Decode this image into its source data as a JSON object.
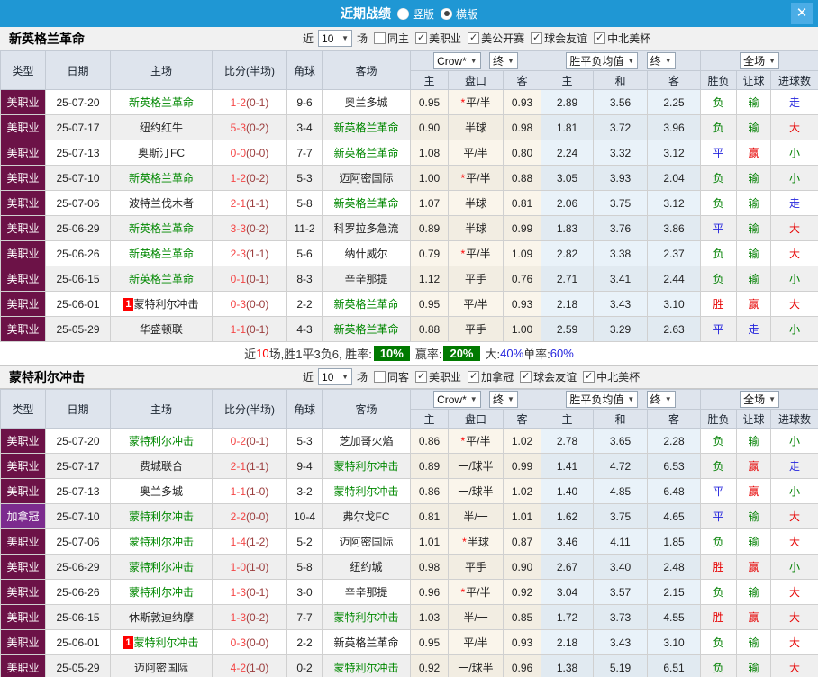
{
  "titlebar": {
    "title": "近期战绩",
    "layout_vertical": "竖版",
    "layout_horizontal": "横版",
    "selected_layout": "横版",
    "close_icon": "✕"
  },
  "table_header": {
    "type": "类型",
    "date": "日期",
    "home": "主场",
    "score": "比分(半场)",
    "corner": "角球",
    "away": "客场",
    "odds_home": "主",
    "odds_line": "盘口",
    "odds_away": "客",
    "avg_home": "主",
    "avg_draw": "和",
    "avg_away": "客",
    "wdl": "胜负",
    "handicap": "让球",
    "goals": "进球数"
  },
  "table_controls": {
    "company": "Crow*",
    "final_left": "终",
    "avg_title": "胜平负均值",
    "final_mid": "终",
    "scope": "全场"
  },
  "colors": {
    "titlebar_bg": "#1f97d4",
    "close_btn_bg": "#4bade6",
    "league_bg": {
      "美职业": "#6c1247",
      "加拿冠": "#7c2b8e"
    },
    "result": {
      "r": "#e60000",
      "b": "#2424dd",
      "g": "#008000"
    },
    "team_highlight": "#008800",
    "score_ft": "#f54545",
    "score_ht": "#9a3c3c",
    "pct_badge_bg": "#007a00",
    "pct_blue": "#2424dd"
  },
  "sections": [
    {
      "team": "新英格兰革命",
      "filters": {
        "near_label": "近",
        "count": "10",
        "unit_label": "场",
        "same_label": "同主",
        "same_checked": false,
        "leagues": [
          "美职业",
          "美公开赛",
          "球会友谊",
          "中北美杯"
        ]
      },
      "rows": [
        {
          "type": "美职业",
          "date": "25-07-20",
          "home": "新英格兰革命",
          "home_hl": true,
          "home_badge": "",
          "ft": "1-2",
          "ht": "(0-1)",
          "corner": "9-6",
          "away": "奥兰多城",
          "away_hl": false,
          "odds": [
            "0.95",
            "*平/半",
            "0.93"
          ],
          "avg": [
            "2.89",
            "3.56",
            "2.25"
          ],
          "res": [
            [
              "负",
              "g"
            ],
            [
              "输",
              "g"
            ],
            [
              "走",
              "b"
            ]
          ]
        },
        {
          "type": "美职业",
          "date": "25-07-17",
          "home": "纽约红牛",
          "home_hl": false,
          "home_badge": "",
          "ft": "5-3",
          "ht": "(0-2)",
          "corner": "3-4",
          "away": "新英格兰革命",
          "away_hl": true,
          "odds": [
            "0.90",
            "半球",
            "0.98"
          ],
          "avg": [
            "1.81",
            "3.72",
            "3.96"
          ],
          "res": [
            [
              "负",
              "g"
            ],
            [
              "输",
              "g"
            ],
            [
              "大",
              "r"
            ]
          ]
        },
        {
          "type": "美职业",
          "date": "25-07-13",
          "home": "奥斯汀FC",
          "home_hl": false,
          "home_badge": "",
          "ft": "0-0",
          "ht": "(0-0)",
          "corner": "7-7",
          "away": "新英格兰革命",
          "away_hl": true,
          "odds": [
            "1.08",
            "平/半",
            "0.80"
          ],
          "avg": [
            "2.24",
            "3.32",
            "3.12"
          ],
          "res": [
            [
              "平",
              "b"
            ],
            [
              "赢",
              "r"
            ],
            [
              "小",
              "g"
            ]
          ]
        },
        {
          "type": "美职业",
          "date": "25-07-10",
          "home": "新英格兰革命",
          "home_hl": true,
          "home_badge": "",
          "ft": "1-2",
          "ht": "(0-2)",
          "corner": "5-3",
          "away": "迈阿密国际",
          "away_hl": false,
          "odds": [
            "1.00",
            "*平/半",
            "0.88"
          ],
          "avg": [
            "3.05",
            "3.93",
            "2.04"
          ],
          "res": [
            [
              "负",
              "g"
            ],
            [
              "输",
              "g"
            ],
            [
              "小",
              "g"
            ]
          ]
        },
        {
          "type": "美职业",
          "date": "25-07-06",
          "home": "波特兰伐木者",
          "home_hl": false,
          "home_badge": "",
          "ft": "2-1",
          "ht": "(1-1)",
          "corner": "5-8",
          "away": "新英格兰革命",
          "away_hl": true,
          "odds": [
            "1.07",
            "半球",
            "0.81"
          ],
          "avg": [
            "2.06",
            "3.75",
            "3.12"
          ],
          "res": [
            [
              "负",
              "g"
            ],
            [
              "输",
              "g"
            ],
            [
              "走",
              "b"
            ]
          ]
        },
        {
          "type": "美职业",
          "date": "25-06-29",
          "home": "新英格兰革命",
          "home_hl": true,
          "home_badge": "",
          "ft": "3-3",
          "ht": "(0-2)",
          "corner": "11-2",
          "away": "科罗拉多急流",
          "away_hl": false,
          "odds": [
            "0.89",
            "半球",
            "0.99"
          ],
          "avg": [
            "1.83",
            "3.76",
            "3.86"
          ],
          "res": [
            [
              "平",
              "b"
            ],
            [
              "输",
              "g"
            ],
            [
              "大",
              "r"
            ]
          ]
        },
        {
          "type": "美职业",
          "date": "25-06-26",
          "home": "新英格兰革命",
          "home_hl": true,
          "home_badge": "",
          "ft": "2-3",
          "ht": "(1-1)",
          "corner": "5-6",
          "away": "纳什威尔",
          "away_hl": false,
          "odds": [
            "0.79",
            "*平/半",
            "1.09"
          ],
          "avg": [
            "2.82",
            "3.38",
            "2.37"
          ],
          "res": [
            [
              "负",
              "g"
            ],
            [
              "输",
              "g"
            ],
            [
              "大",
              "r"
            ]
          ]
        },
        {
          "type": "美职业",
          "date": "25-06-15",
          "home": "新英格兰革命",
          "home_hl": true,
          "home_badge": "",
          "ft": "0-1",
          "ht": "(0-1)",
          "corner": "8-3",
          "away": "辛辛那提",
          "away_hl": false,
          "odds": [
            "1.12",
            "平手",
            "0.76"
          ],
          "avg": [
            "2.71",
            "3.41",
            "2.44"
          ],
          "res": [
            [
              "负",
              "g"
            ],
            [
              "输",
              "g"
            ],
            [
              "小",
              "g"
            ]
          ]
        },
        {
          "type": "美职业",
          "date": "25-06-01",
          "home": "蒙特利尔冲击",
          "home_hl": false,
          "home_badge": "1",
          "ft": "0-3",
          "ht": "(0-0)",
          "corner": "2-2",
          "away": "新英格兰革命",
          "away_hl": true,
          "odds": [
            "0.95",
            "平/半",
            "0.93"
          ],
          "avg": [
            "2.18",
            "3.43",
            "3.10"
          ],
          "res": [
            [
              "胜",
              "r"
            ],
            [
              "赢",
              "r"
            ],
            [
              "大",
              "r"
            ]
          ]
        },
        {
          "type": "美职业",
          "date": "25-05-29",
          "home": "华盛顿联",
          "home_hl": false,
          "home_badge": "",
          "ft": "1-1",
          "ht": "(0-1)",
          "corner": "4-3",
          "away": "新英格兰革命",
          "away_hl": true,
          "odds": [
            "0.88",
            "平手",
            "1.00"
          ],
          "avg": [
            "2.59",
            "3.29",
            "2.63"
          ],
          "res": [
            [
              "平",
              "b"
            ],
            [
              "走",
              "b"
            ],
            [
              "小",
              "g"
            ]
          ]
        }
      ],
      "summary": {
        "near_label": "近",
        "near_count": "10",
        "tail": "场,胜1平3负6, ",
        "rate_label": "胜率:",
        "rate_value": "10%",
        "win_label": "赢率:",
        "win_value": "20%",
        "big_label": "大:",
        "big_value": "40%",
        "single_label": "单率:",
        "single_value": "60%"
      }
    },
    {
      "team": "蒙特利尔冲击",
      "filters": {
        "near_label": "近",
        "count": "10",
        "unit_label": "场",
        "same_label": "同客",
        "same_checked": false,
        "leagues": [
          "美职业",
          "加拿冠",
          "球会友谊",
          "中北美杯"
        ]
      },
      "rows": [
        {
          "type": "美职业",
          "date": "25-07-20",
          "home": "蒙特利尔冲击",
          "home_hl": true,
          "home_badge": "",
          "ft": "0-2",
          "ht": "(0-1)",
          "corner": "5-3",
          "away": "芝加哥火焰",
          "away_hl": false,
          "odds": [
            "0.86",
            "*平/半",
            "1.02"
          ],
          "avg": [
            "2.78",
            "3.65",
            "2.28"
          ],
          "res": [
            [
              "负",
              "g"
            ],
            [
              "输",
              "g"
            ],
            [
              "小",
              "g"
            ]
          ]
        },
        {
          "type": "美职业",
          "date": "25-07-17",
          "home": "费城联合",
          "home_hl": false,
          "home_badge": "",
          "ft": "2-1",
          "ht": "(1-1)",
          "corner": "9-4",
          "away": "蒙特利尔冲击",
          "away_hl": true,
          "odds": [
            "0.89",
            "一/球半",
            "0.99"
          ],
          "avg": [
            "1.41",
            "4.72",
            "6.53"
          ],
          "res": [
            [
              "负",
              "g"
            ],
            [
              "赢",
              "r"
            ],
            [
              "走",
              "b"
            ]
          ]
        },
        {
          "type": "美职业",
          "date": "25-07-13",
          "home": "奥兰多城",
          "home_hl": false,
          "home_badge": "",
          "ft": "1-1",
          "ht": "(1-0)",
          "corner": "3-2",
          "away": "蒙特利尔冲击",
          "away_hl": true,
          "odds": [
            "0.86",
            "一/球半",
            "1.02"
          ],
          "avg": [
            "1.40",
            "4.85",
            "6.48"
          ],
          "res": [
            [
              "平",
              "b"
            ],
            [
              "赢",
              "r"
            ],
            [
              "小",
              "g"
            ]
          ]
        },
        {
          "type": "加拿冠",
          "date": "25-07-10",
          "home": "蒙特利尔冲击",
          "home_hl": true,
          "home_badge": "",
          "ft": "2-2",
          "ht": "(0-0)",
          "corner": "10-4",
          "away": "弗尔戈FC",
          "away_hl": false,
          "odds": [
            "0.81",
            "半/一",
            "1.01"
          ],
          "avg": [
            "1.62",
            "3.75",
            "4.65"
          ],
          "res": [
            [
              "平",
              "b"
            ],
            [
              "输",
              "g"
            ],
            [
              "大",
              "r"
            ]
          ]
        },
        {
          "type": "美职业",
          "date": "25-07-06",
          "home": "蒙特利尔冲击",
          "home_hl": true,
          "home_badge": "",
          "ft": "1-4",
          "ht": "(1-2)",
          "corner": "5-2",
          "away": "迈阿密国际",
          "away_hl": false,
          "odds": [
            "1.01",
            "*半球",
            "0.87"
          ],
          "avg": [
            "3.46",
            "4.11",
            "1.85"
          ],
          "res": [
            [
              "负",
              "g"
            ],
            [
              "输",
              "g"
            ],
            [
              "大",
              "r"
            ]
          ]
        },
        {
          "type": "美职业",
          "date": "25-06-29",
          "home": "蒙特利尔冲击",
          "home_hl": true,
          "home_badge": "",
          "ft": "1-0",
          "ht": "(1-0)",
          "corner": "5-8",
          "away": "纽约城",
          "away_hl": false,
          "odds": [
            "0.98",
            "平手",
            "0.90"
          ],
          "avg": [
            "2.67",
            "3.40",
            "2.48"
          ],
          "res": [
            [
              "胜",
              "r"
            ],
            [
              "赢",
              "r"
            ],
            [
              "小",
              "g"
            ]
          ]
        },
        {
          "type": "美职业",
          "date": "25-06-26",
          "home": "蒙特利尔冲击",
          "home_hl": true,
          "home_badge": "",
          "ft": "1-3",
          "ht": "(0-1)",
          "corner": "3-0",
          "away": "辛辛那提",
          "away_hl": false,
          "odds": [
            "0.96",
            "*平/半",
            "0.92"
          ],
          "avg": [
            "3.04",
            "3.57",
            "2.15"
          ],
          "res": [
            [
              "负",
              "g"
            ],
            [
              "输",
              "g"
            ],
            [
              "大",
              "r"
            ]
          ]
        },
        {
          "type": "美职业",
          "date": "25-06-15",
          "home": "休斯敦迪纳摩",
          "home_hl": false,
          "home_badge": "",
          "ft": "1-3",
          "ht": "(0-2)",
          "corner": "7-7",
          "away": "蒙特利尔冲击",
          "away_hl": true,
          "odds": [
            "1.03",
            "半/一",
            "0.85"
          ],
          "avg": [
            "1.72",
            "3.73",
            "4.55"
          ],
          "res": [
            [
              "胜",
              "r"
            ],
            [
              "赢",
              "r"
            ],
            [
              "大",
              "r"
            ]
          ]
        },
        {
          "type": "美职业",
          "date": "25-06-01",
          "home": "蒙特利尔冲击",
          "home_hl": true,
          "home_badge": "1",
          "ft": "0-3",
          "ht": "(0-0)",
          "corner": "2-2",
          "away": "新英格兰革命",
          "away_hl": false,
          "odds": [
            "0.95",
            "平/半",
            "0.93"
          ],
          "avg": [
            "2.18",
            "3.43",
            "3.10"
          ],
          "res": [
            [
              "负",
              "g"
            ],
            [
              "输",
              "g"
            ],
            [
              "大",
              "r"
            ]
          ]
        },
        {
          "type": "美职业",
          "date": "25-05-29",
          "home": "迈阿密国际",
          "home_hl": false,
          "home_badge": "",
          "ft": "4-2",
          "ht": "(1-0)",
          "corner": "0-2",
          "away": "蒙特利尔冲击",
          "away_hl": true,
          "odds": [
            "0.92",
            "一/球半",
            "0.96"
          ],
          "avg": [
            "1.38",
            "5.19",
            "6.51"
          ],
          "res": [
            [
              "负",
              "g"
            ],
            [
              "输",
              "g"
            ],
            [
              "大",
              "r"
            ]
          ]
        }
      ]
    }
  ]
}
